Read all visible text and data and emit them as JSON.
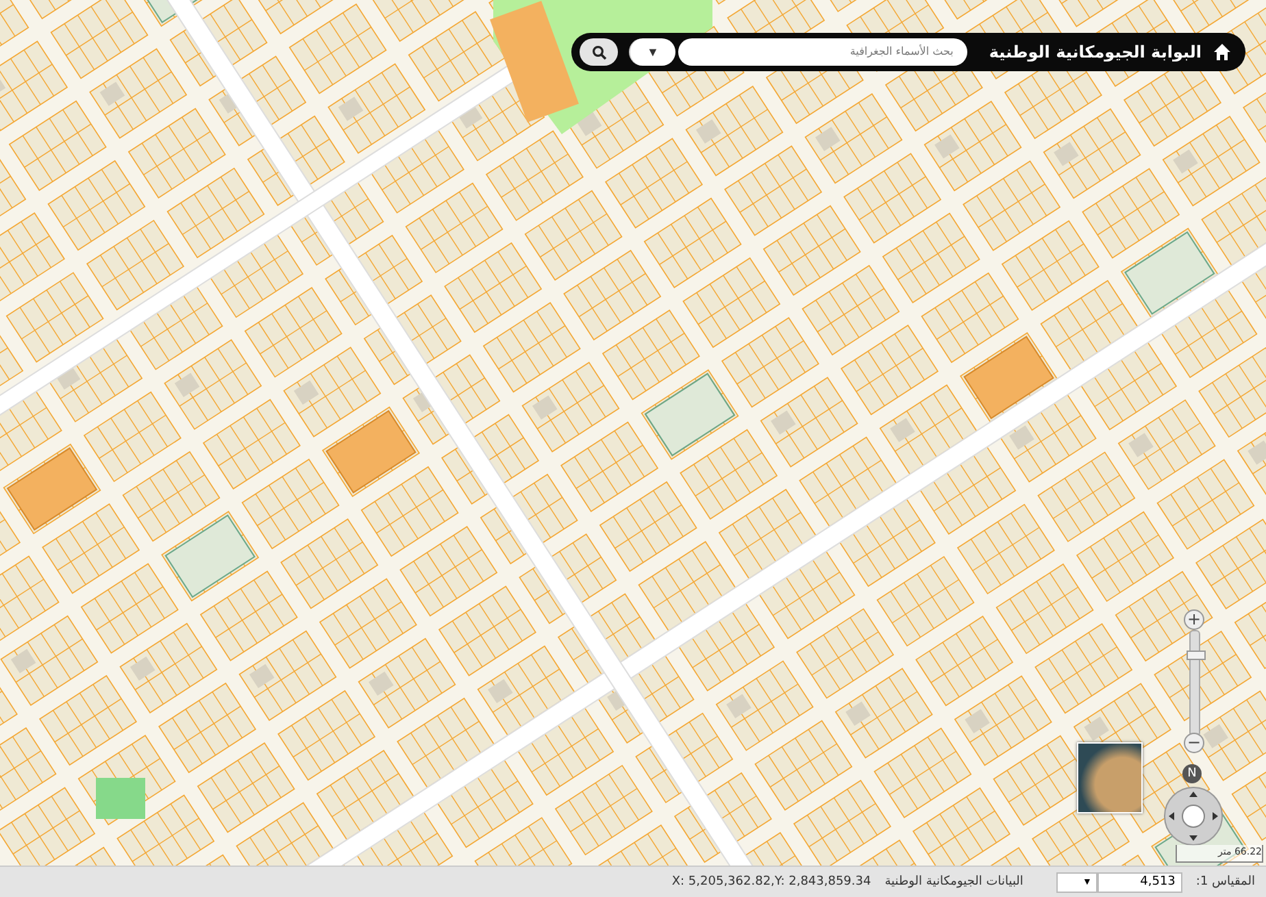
{
  "header": {
    "title": "البوابة الجيومكانية الوطنية",
    "search": {
      "placeholder": "بحث الأسماء الجغرافية"
    },
    "dropdown_glyph": "▼"
  },
  "map_controls": {
    "zoom_in": "+",
    "zoom_out": "−",
    "zoom": {
      "level": 0.77
    },
    "north_label": "N",
    "scale_bar": "66.22 متر"
  },
  "status_bar": {
    "scale_label": "المقياس 1:",
    "scale_value": "4,513",
    "dropdown_glyph": "▼",
    "layer": "البيانات الجيومكانية الوطنية",
    "coordinates": "X: 5,205,362.82,Y: 2,843,859.34"
  }
}
